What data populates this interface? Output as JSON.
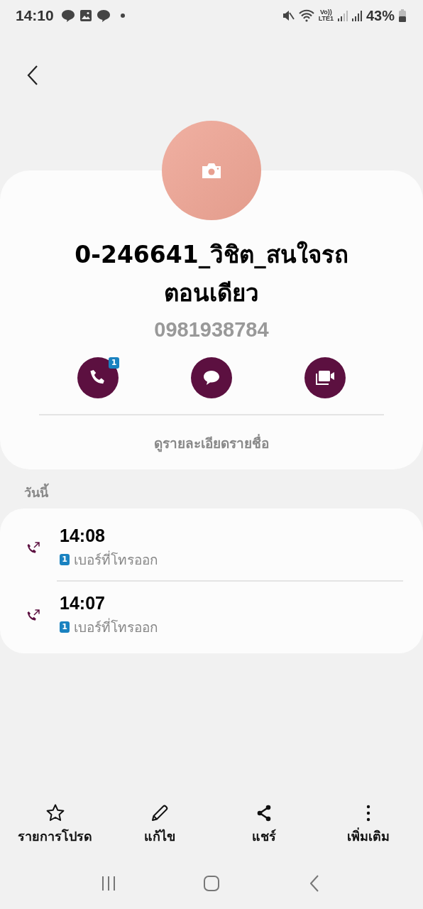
{
  "status_bar": {
    "time": "14:10",
    "volte": "Vo))",
    "network": "LTE1",
    "battery": "43%"
  },
  "contact": {
    "name": "0-246641_วิชิต_สนใจรถตอนเดียว",
    "number": "0981938784",
    "call_badge": "1",
    "details_link": "ดูรายละเอียดรายชื่อ"
  },
  "actions": [
    {
      "kind": "call"
    },
    {
      "kind": "message"
    },
    {
      "kind": "video"
    }
  ],
  "log": {
    "heading": "วันนี้",
    "entries": [
      {
        "time": "14:08",
        "sim": "1",
        "label": "เบอร์ที่โทรออก"
      },
      {
        "time": "14:07",
        "sim": "1",
        "label": "เบอร์ที่โทรออก"
      }
    ]
  },
  "bottom_actions": [
    {
      "kind": "favorite",
      "label": "รายการโปรด"
    },
    {
      "kind": "edit",
      "label": "แก้ไข"
    },
    {
      "kind": "share",
      "label": "แชร์"
    },
    {
      "kind": "more",
      "label": "เพิ่มเติม"
    }
  ]
}
